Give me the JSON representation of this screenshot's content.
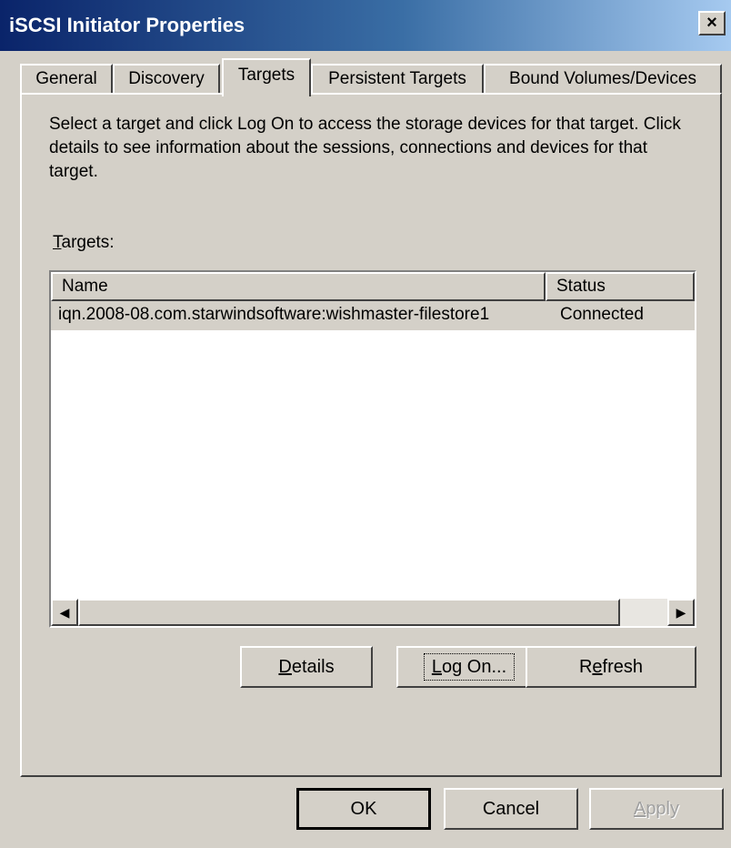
{
  "window": {
    "title": "iSCSI Initiator Properties",
    "close_label": "×"
  },
  "tabs": [
    {
      "label": "General"
    },
    {
      "label": "Discovery"
    },
    {
      "label": "Targets"
    },
    {
      "label": "Persistent Targets"
    },
    {
      "label": "Bound Volumes/Devices"
    }
  ],
  "active_tab": "Targets",
  "description": "Select a target and click Log On to access the storage devices for that target. Click details to see information about the sessions, connections and devices for that target.",
  "targets_label": {
    "mnemonic": "T",
    "rest": "argets:"
  },
  "targets_table": {
    "columns": [
      "Name",
      "Status"
    ],
    "rows": [
      {
        "name": "iqn.2008-08.com.starwindsoftware:wishmaster-filestore1",
        "status": "Connected"
      }
    ]
  },
  "buttons": {
    "details": {
      "mnemonic": "D",
      "rest": "etails"
    },
    "logon": {
      "mnemonic": "L",
      "rest": "og On..."
    },
    "refresh_pre": "R",
    "refresh_mnemonic": "e",
    "refresh_post": "fresh",
    "ok": "OK",
    "cancel": "Cancel",
    "apply": {
      "mnemonic": "A",
      "rest": "pply"
    }
  },
  "colors": {
    "title_active": "#0a246a",
    "face": "#d4d0c8"
  }
}
